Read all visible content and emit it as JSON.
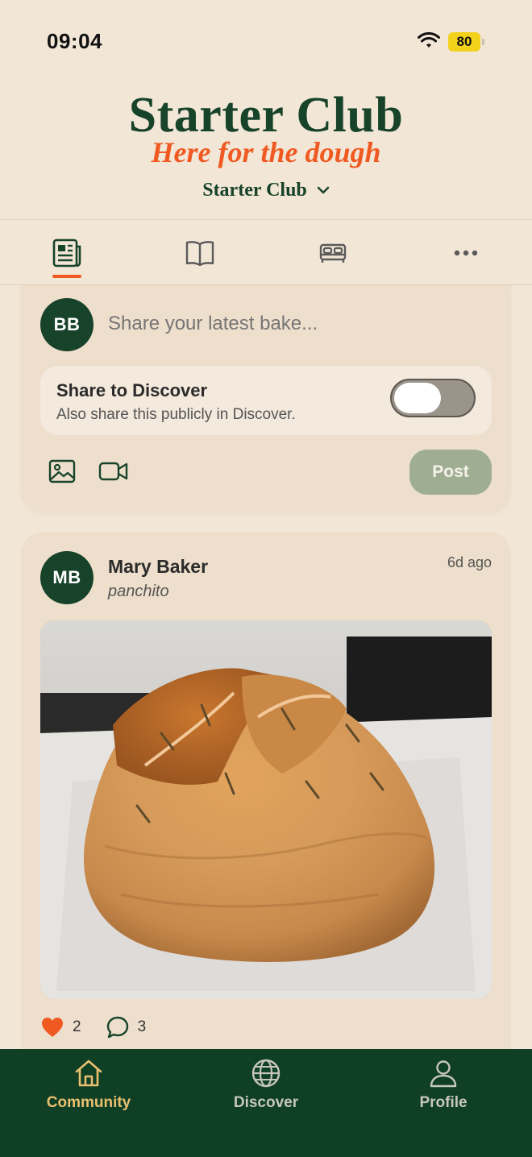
{
  "status_bar": {
    "time": "09:04",
    "battery": "80"
  },
  "header": {
    "title": "Starter Club",
    "tagline": "Here for the dough",
    "club_name": "Starter Club"
  },
  "tabs": [
    {
      "icon": "newspaper-icon",
      "active": true
    },
    {
      "icon": "book-icon",
      "active": false
    },
    {
      "icon": "bed-icon",
      "active": false
    },
    {
      "icon": "more-icon",
      "active": false
    }
  ],
  "composer": {
    "avatar_initials": "BB",
    "placeholder": "Share your latest bake...",
    "share_title": "Share to Discover",
    "share_description": "Also share this publicly in Discover.",
    "share_enabled": false,
    "post_label": "Post"
  },
  "post": {
    "avatar_initials": "MB",
    "author": "Mary Baker",
    "subtitle": "panchito",
    "time": "6d ago",
    "likes": "2",
    "comments": "3"
  },
  "nav": {
    "items": [
      {
        "label": "Community",
        "icon": "home-icon",
        "active": true
      },
      {
        "label": "Discover",
        "icon": "globe-icon",
        "active": false
      },
      {
        "label": "Profile",
        "icon": "user-icon",
        "active": false
      }
    ]
  },
  "colors": {
    "background": "#f2e6d6",
    "brand_green": "#17432a",
    "accent_orange": "#f05a22",
    "nav_active": "#e8c070",
    "nav_inactive": "#c7c7bd"
  }
}
